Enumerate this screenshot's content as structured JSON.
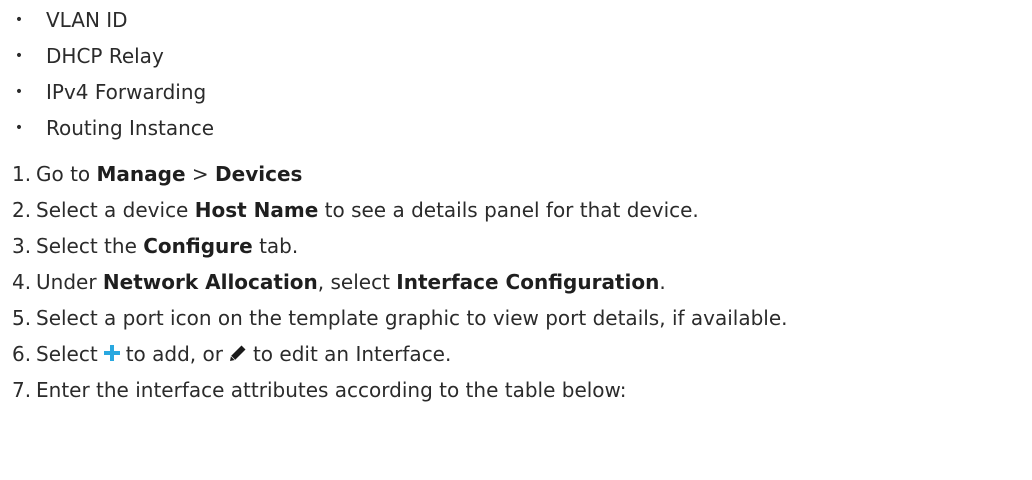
{
  "bullets": [
    "VLAN ID",
    "DHCP Relay",
    "IPv4 Forwarding",
    "Routing Instance"
  ],
  "steps": [
    {
      "num": "1.",
      "parts": [
        "Go to ",
        "Manage",
        " > ",
        "Devices"
      ]
    },
    {
      "num": "2.",
      "parts": [
        "Select a device ",
        "Host Name",
        " to see a details panel for that device."
      ]
    },
    {
      "num": "3.",
      "parts": [
        "Select the ",
        "Configure",
        " tab."
      ]
    },
    {
      "num": "4.",
      "parts": [
        "Under ",
        "Network Allocation",
        ", select ",
        "Interface Configuration",
        "."
      ]
    },
    {
      "num": "5.",
      "text": "Select a port icon on the template graphic to view port details, if available."
    },
    {
      "num": "6.",
      "before": "Select",
      "middle": "to add, or",
      "after": "to edit an Interface."
    },
    {
      "num": "7.",
      "text": "Enter the interface attributes according to the table below:"
    }
  ],
  "icons": {
    "add": "plus-icon",
    "edit": "pencil-icon",
    "add_color": "#29a8e0",
    "edit_color": "#1a1a1a"
  }
}
